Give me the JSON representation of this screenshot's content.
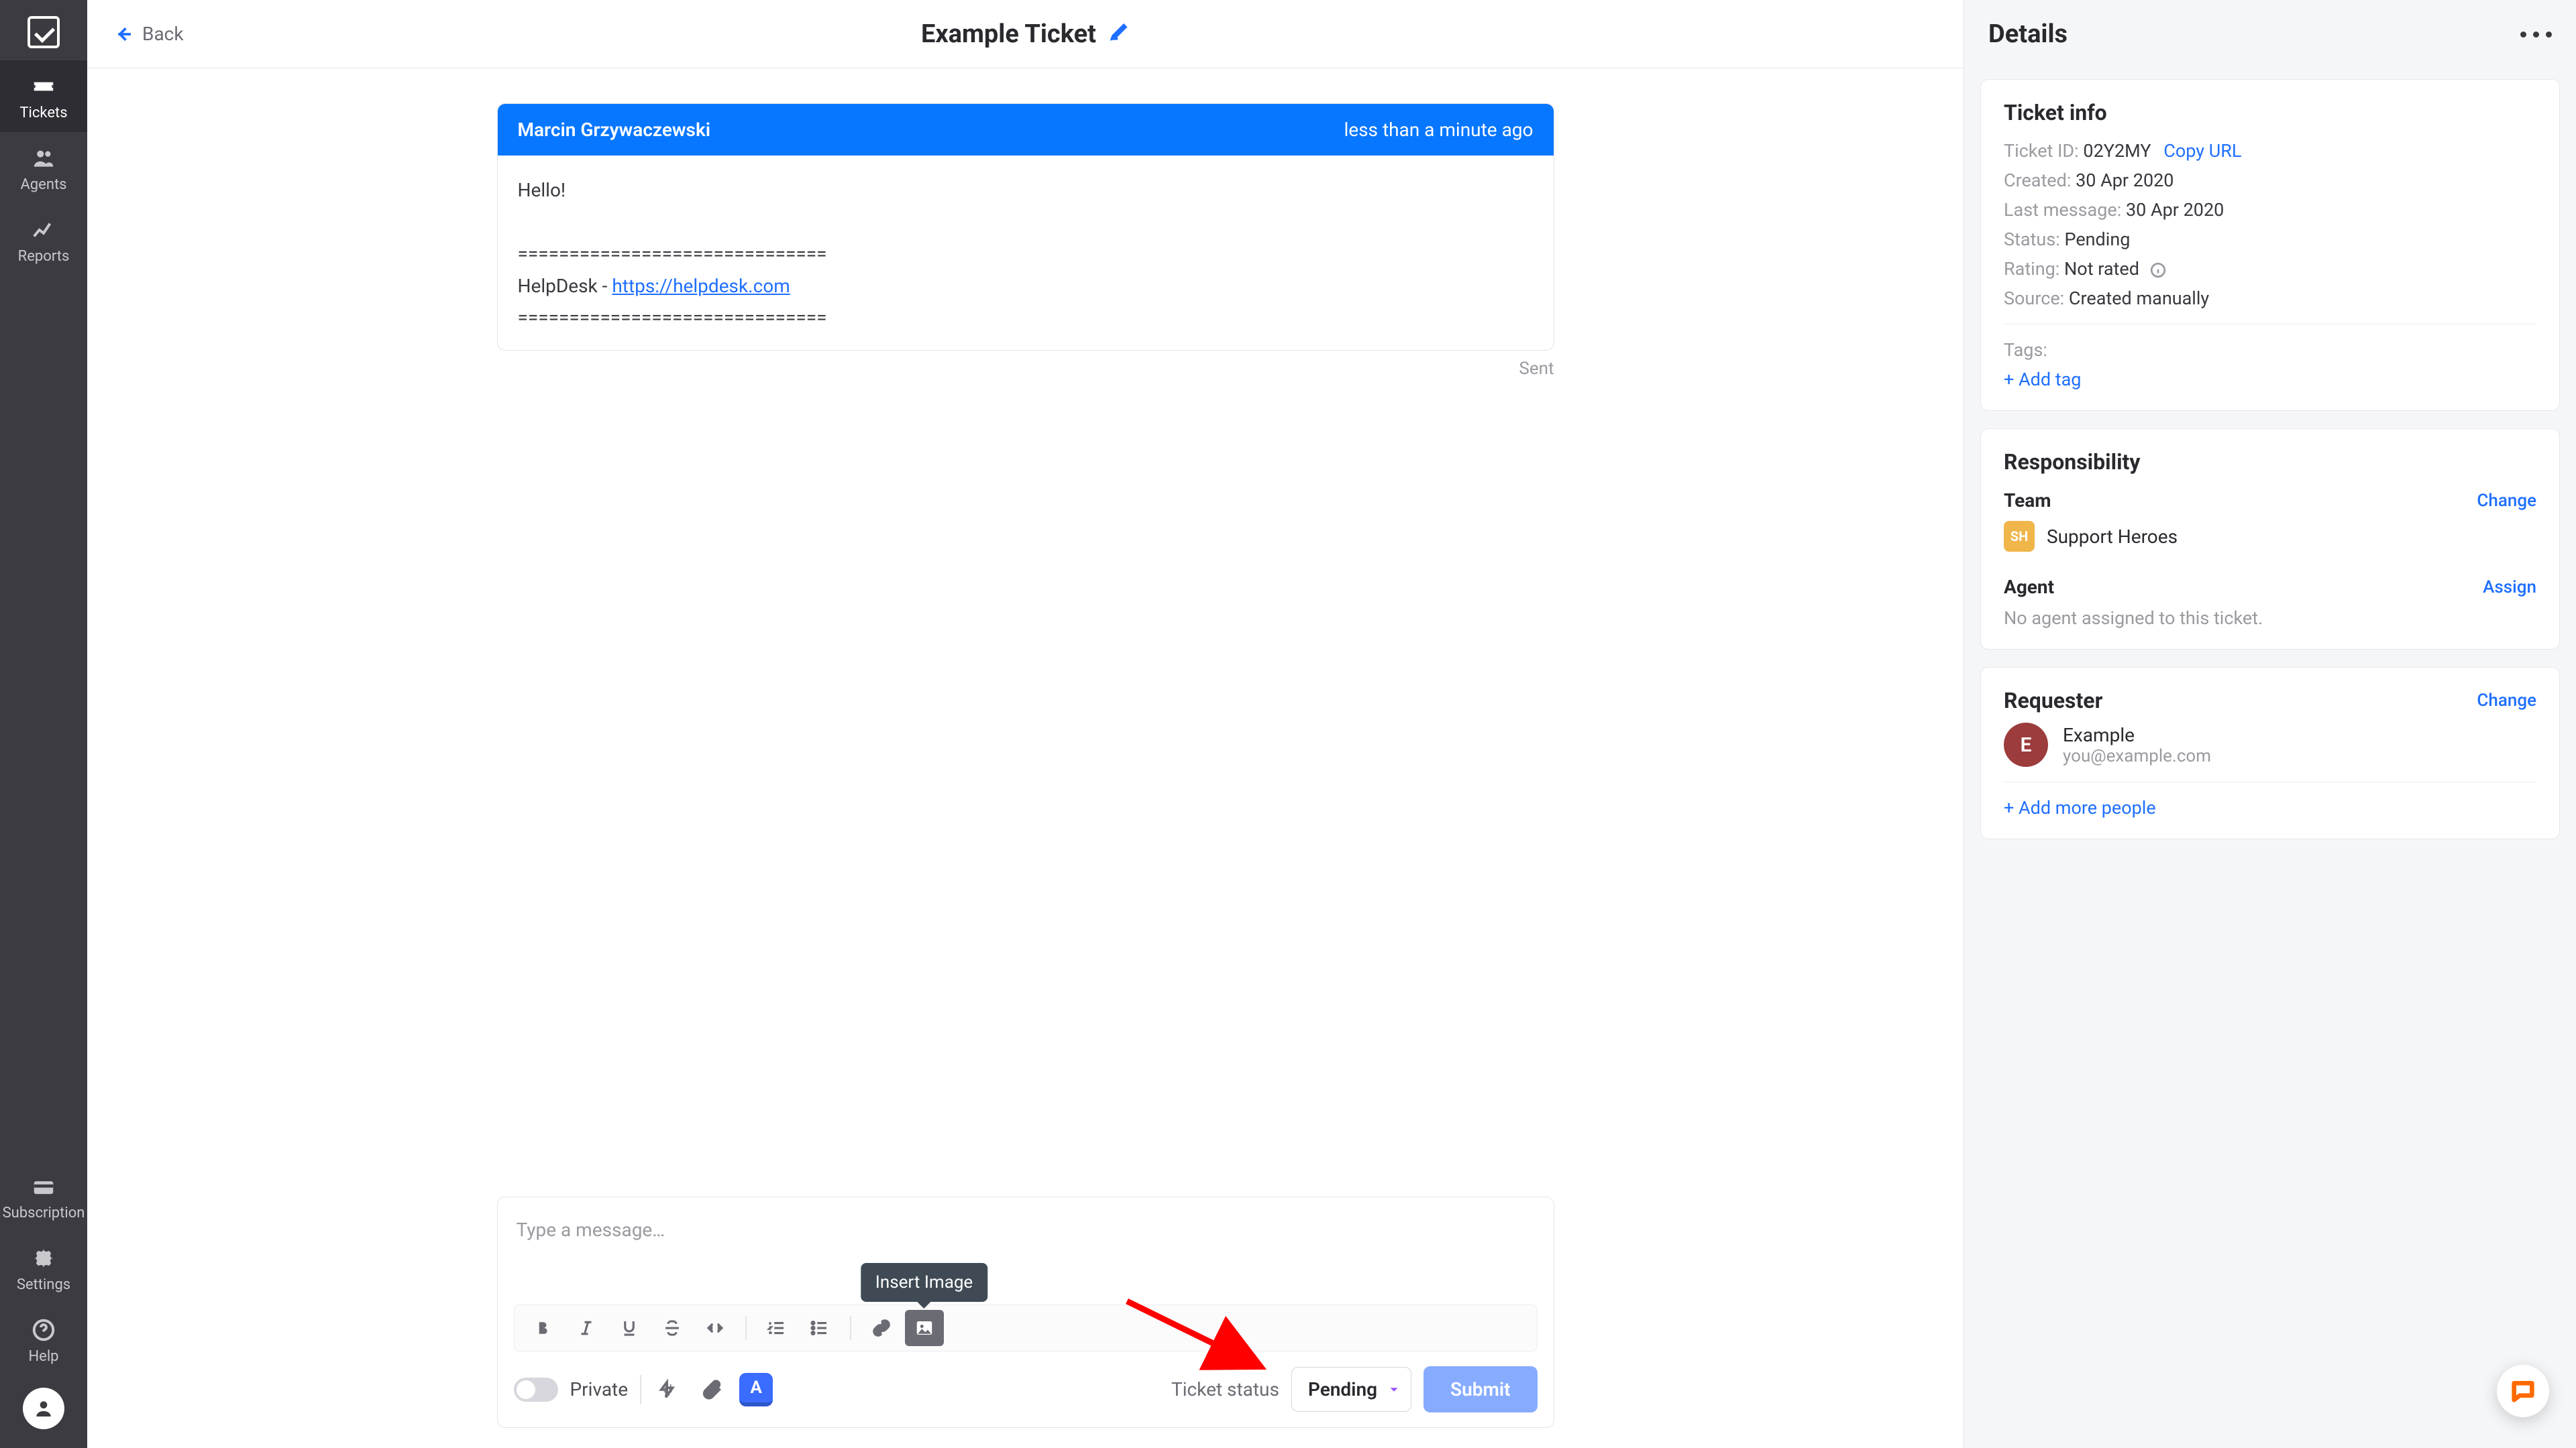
{
  "nav": {
    "items": [
      {
        "label": "Tickets"
      },
      {
        "label": "Agents"
      },
      {
        "label": "Reports"
      }
    ],
    "bottom": [
      {
        "label": "Subscription"
      },
      {
        "label": "Settings"
      },
      {
        "label": "Help"
      }
    ]
  },
  "header": {
    "back_label": "Back",
    "title": "Example Ticket"
  },
  "message": {
    "author": "Marcin Grzywaczewski",
    "timestamp": "less than a minute ago",
    "greeting": "Hello!",
    "sep": "==============================",
    "sig_prefix": "HelpDesk - ",
    "sig_link": "https://helpdesk.com",
    "status": "Sent"
  },
  "composer": {
    "placeholder": "Type a message…",
    "tooltip": "Insert Image",
    "private_label": "Private",
    "color_chip_letter": "A",
    "ticket_status_label": "Ticket status",
    "status_value": "Pending",
    "submit_label": "Submit"
  },
  "details": {
    "title": "Details",
    "ticket_info": {
      "heading": "Ticket info",
      "id_label": "Ticket ID:",
      "id_value": "02Y2MY",
      "copy_label": "Copy URL",
      "created_label": "Created:",
      "created_value": "30 Apr 2020",
      "last_label": "Last message:",
      "last_value": "30 Apr 2020",
      "status_label": "Status:",
      "status_value": "Pending",
      "rating_label": "Rating:",
      "rating_value": "Not rated",
      "source_label": "Source:",
      "source_value": "Created manually",
      "tags_label": "Tags:",
      "add_tag": "+ Add tag"
    },
    "responsibility": {
      "heading": "Responsibility",
      "team_label": "Team",
      "team_change": "Change",
      "team_badge": "SH",
      "team_name": "Support Heroes",
      "agent_label": "Agent",
      "agent_assign": "Assign",
      "agent_empty": "No agent assigned to this ticket."
    },
    "requester": {
      "heading": "Requester",
      "change": "Change",
      "initial": "E",
      "name": "Example",
      "email": "you@example.com",
      "add_people": "+ Add more people"
    }
  }
}
